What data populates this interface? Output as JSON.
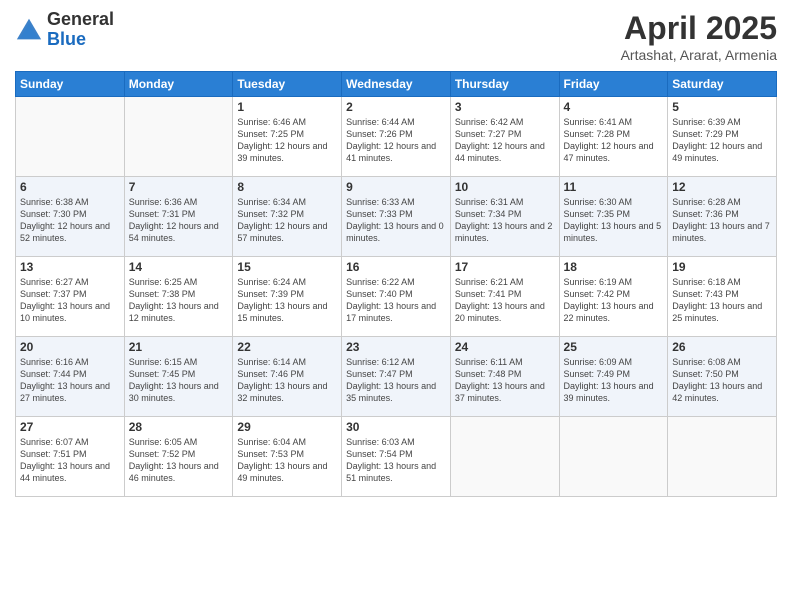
{
  "logo": {
    "general": "General",
    "blue": "Blue"
  },
  "title": "April 2025",
  "subtitle": "Artashat, Ararat, Armenia",
  "headers": [
    "Sunday",
    "Monday",
    "Tuesday",
    "Wednesday",
    "Thursday",
    "Friday",
    "Saturday"
  ],
  "weeks": [
    [
      {
        "day": "",
        "sunrise": "",
        "sunset": "",
        "daylight": ""
      },
      {
        "day": "",
        "sunrise": "",
        "sunset": "",
        "daylight": ""
      },
      {
        "day": "1",
        "sunrise": "Sunrise: 6:46 AM",
        "sunset": "Sunset: 7:25 PM",
        "daylight": "Daylight: 12 hours and 39 minutes."
      },
      {
        "day": "2",
        "sunrise": "Sunrise: 6:44 AM",
        "sunset": "Sunset: 7:26 PM",
        "daylight": "Daylight: 12 hours and 41 minutes."
      },
      {
        "day": "3",
        "sunrise": "Sunrise: 6:42 AM",
        "sunset": "Sunset: 7:27 PM",
        "daylight": "Daylight: 12 hours and 44 minutes."
      },
      {
        "day": "4",
        "sunrise": "Sunrise: 6:41 AM",
        "sunset": "Sunset: 7:28 PM",
        "daylight": "Daylight: 12 hours and 47 minutes."
      },
      {
        "day": "5",
        "sunrise": "Sunrise: 6:39 AM",
        "sunset": "Sunset: 7:29 PM",
        "daylight": "Daylight: 12 hours and 49 minutes."
      }
    ],
    [
      {
        "day": "6",
        "sunrise": "Sunrise: 6:38 AM",
        "sunset": "Sunset: 7:30 PM",
        "daylight": "Daylight: 12 hours and 52 minutes."
      },
      {
        "day": "7",
        "sunrise": "Sunrise: 6:36 AM",
        "sunset": "Sunset: 7:31 PM",
        "daylight": "Daylight: 12 hours and 54 minutes."
      },
      {
        "day": "8",
        "sunrise": "Sunrise: 6:34 AM",
        "sunset": "Sunset: 7:32 PM",
        "daylight": "Daylight: 12 hours and 57 minutes."
      },
      {
        "day": "9",
        "sunrise": "Sunrise: 6:33 AM",
        "sunset": "Sunset: 7:33 PM",
        "daylight": "Daylight: 13 hours and 0 minutes."
      },
      {
        "day": "10",
        "sunrise": "Sunrise: 6:31 AM",
        "sunset": "Sunset: 7:34 PM",
        "daylight": "Daylight: 13 hours and 2 minutes."
      },
      {
        "day": "11",
        "sunrise": "Sunrise: 6:30 AM",
        "sunset": "Sunset: 7:35 PM",
        "daylight": "Daylight: 13 hours and 5 minutes."
      },
      {
        "day": "12",
        "sunrise": "Sunrise: 6:28 AM",
        "sunset": "Sunset: 7:36 PM",
        "daylight": "Daylight: 13 hours and 7 minutes."
      }
    ],
    [
      {
        "day": "13",
        "sunrise": "Sunrise: 6:27 AM",
        "sunset": "Sunset: 7:37 PM",
        "daylight": "Daylight: 13 hours and 10 minutes."
      },
      {
        "day": "14",
        "sunrise": "Sunrise: 6:25 AM",
        "sunset": "Sunset: 7:38 PM",
        "daylight": "Daylight: 13 hours and 12 minutes."
      },
      {
        "day": "15",
        "sunrise": "Sunrise: 6:24 AM",
        "sunset": "Sunset: 7:39 PM",
        "daylight": "Daylight: 13 hours and 15 minutes."
      },
      {
        "day": "16",
        "sunrise": "Sunrise: 6:22 AM",
        "sunset": "Sunset: 7:40 PM",
        "daylight": "Daylight: 13 hours and 17 minutes."
      },
      {
        "day": "17",
        "sunrise": "Sunrise: 6:21 AM",
        "sunset": "Sunset: 7:41 PM",
        "daylight": "Daylight: 13 hours and 20 minutes."
      },
      {
        "day": "18",
        "sunrise": "Sunrise: 6:19 AM",
        "sunset": "Sunset: 7:42 PM",
        "daylight": "Daylight: 13 hours and 22 minutes."
      },
      {
        "day": "19",
        "sunrise": "Sunrise: 6:18 AM",
        "sunset": "Sunset: 7:43 PM",
        "daylight": "Daylight: 13 hours and 25 minutes."
      }
    ],
    [
      {
        "day": "20",
        "sunrise": "Sunrise: 6:16 AM",
        "sunset": "Sunset: 7:44 PM",
        "daylight": "Daylight: 13 hours and 27 minutes."
      },
      {
        "day": "21",
        "sunrise": "Sunrise: 6:15 AM",
        "sunset": "Sunset: 7:45 PM",
        "daylight": "Daylight: 13 hours and 30 minutes."
      },
      {
        "day": "22",
        "sunrise": "Sunrise: 6:14 AM",
        "sunset": "Sunset: 7:46 PM",
        "daylight": "Daylight: 13 hours and 32 minutes."
      },
      {
        "day": "23",
        "sunrise": "Sunrise: 6:12 AM",
        "sunset": "Sunset: 7:47 PM",
        "daylight": "Daylight: 13 hours and 35 minutes."
      },
      {
        "day": "24",
        "sunrise": "Sunrise: 6:11 AM",
        "sunset": "Sunset: 7:48 PM",
        "daylight": "Daylight: 13 hours and 37 minutes."
      },
      {
        "day": "25",
        "sunrise": "Sunrise: 6:09 AM",
        "sunset": "Sunset: 7:49 PM",
        "daylight": "Daylight: 13 hours and 39 minutes."
      },
      {
        "day": "26",
        "sunrise": "Sunrise: 6:08 AM",
        "sunset": "Sunset: 7:50 PM",
        "daylight": "Daylight: 13 hours and 42 minutes."
      }
    ],
    [
      {
        "day": "27",
        "sunrise": "Sunrise: 6:07 AM",
        "sunset": "Sunset: 7:51 PM",
        "daylight": "Daylight: 13 hours and 44 minutes."
      },
      {
        "day": "28",
        "sunrise": "Sunrise: 6:05 AM",
        "sunset": "Sunset: 7:52 PM",
        "daylight": "Daylight: 13 hours and 46 minutes."
      },
      {
        "day": "29",
        "sunrise": "Sunrise: 6:04 AM",
        "sunset": "Sunset: 7:53 PM",
        "daylight": "Daylight: 13 hours and 49 minutes."
      },
      {
        "day": "30",
        "sunrise": "Sunrise: 6:03 AM",
        "sunset": "Sunset: 7:54 PM",
        "daylight": "Daylight: 13 hours and 51 minutes."
      },
      {
        "day": "",
        "sunrise": "",
        "sunset": "",
        "daylight": ""
      },
      {
        "day": "",
        "sunrise": "",
        "sunset": "",
        "daylight": ""
      },
      {
        "day": "",
        "sunrise": "",
        "sunset": "",
        "daylight": ""
      }
    ]
  ]
}
